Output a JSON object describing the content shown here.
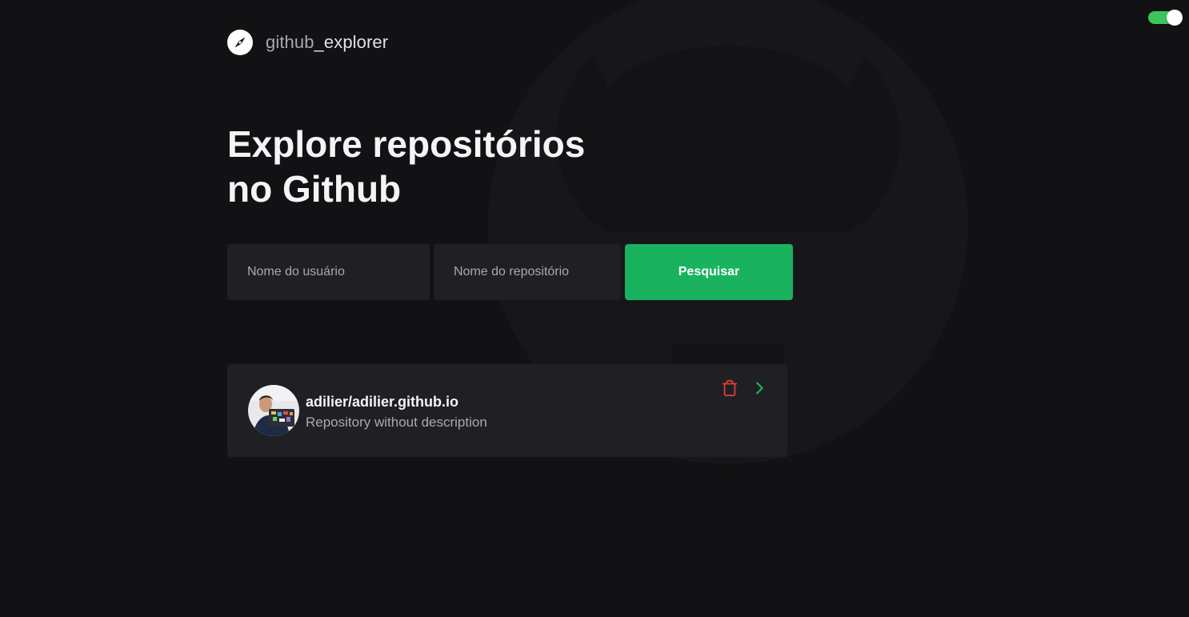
{
  "app": {
    "logo_prefix": "github",
    "logo_suffix": "_explorer"
  },
  "theme_toggle": {
    "state": "on",
    "color": "#3cc65a"
  },
  "hero": {
    "title_line1": "Explore repositórios",
    "title_line2": "no Github"
  },
  "search": {
    "user_placeholder": "Nome do usuário",
    "user_value": "",
    "repo_placeholder": "Nome do repositório",
    "repo_value": "",
    "button_label": "Pesquisar",
    "button_color": "#19b35f"
  },
  "repositories": [
    {
      "full_name": "adilier/adilier.github.io",
      "description": "Repository without description",
      "avatar_icon": "user-avatar",
      "delete_icon": "trash-icon",
      "delete_color": "#e03a3a",
      "open_icon": "chevron-right-icon",
      "open_color": "#19b35f"
    }
  ],
  "colors": {
    "background": "#121214",
    "surface": "#202024",
    "text_primary": "#f4f4f6",
    "text_secondary": "#a8a8b3"
  }
}
